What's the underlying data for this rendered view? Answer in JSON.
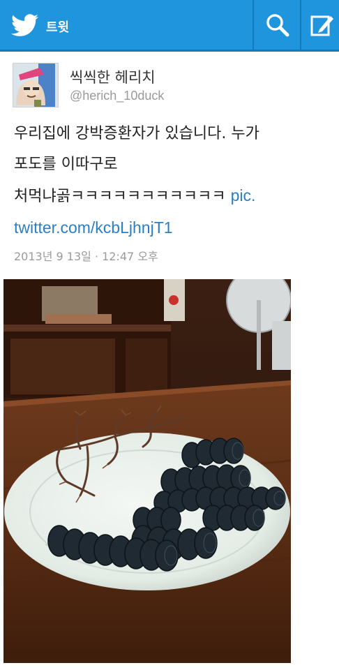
{
  "header": {
    "title": "트윗",
    "icons": [
      "twitter-bird-icon",
      "search-icon",
      "compose-icon"
    ],
    "colors": {
      "bar": "#1f95dd",
      "divider": "#137bbd"
    }
  },
  "tweet": {
    "author_name": "씩씩한 헤리치",
    "author_handle": "@herich_10duck",
    "text_line1": "우리집에 강박증환자가 있습니다. 누가",
    "text_line2": "포도를 이따구로",
    "text_line3": "처먹냐곩ㅋㅋㅋㅋㅋㅋㅋㅋㅋㅋㅋ ",
    "link_part1": "pic.",
    "link_part2": "twitter.com/kcbLjhnjT1",
    "timestamp": "2013년 9 13일 · 12:47 오후"
  },
  "photo": {
    "description_icon": "photo-grapes-on-plate"
  }
}
